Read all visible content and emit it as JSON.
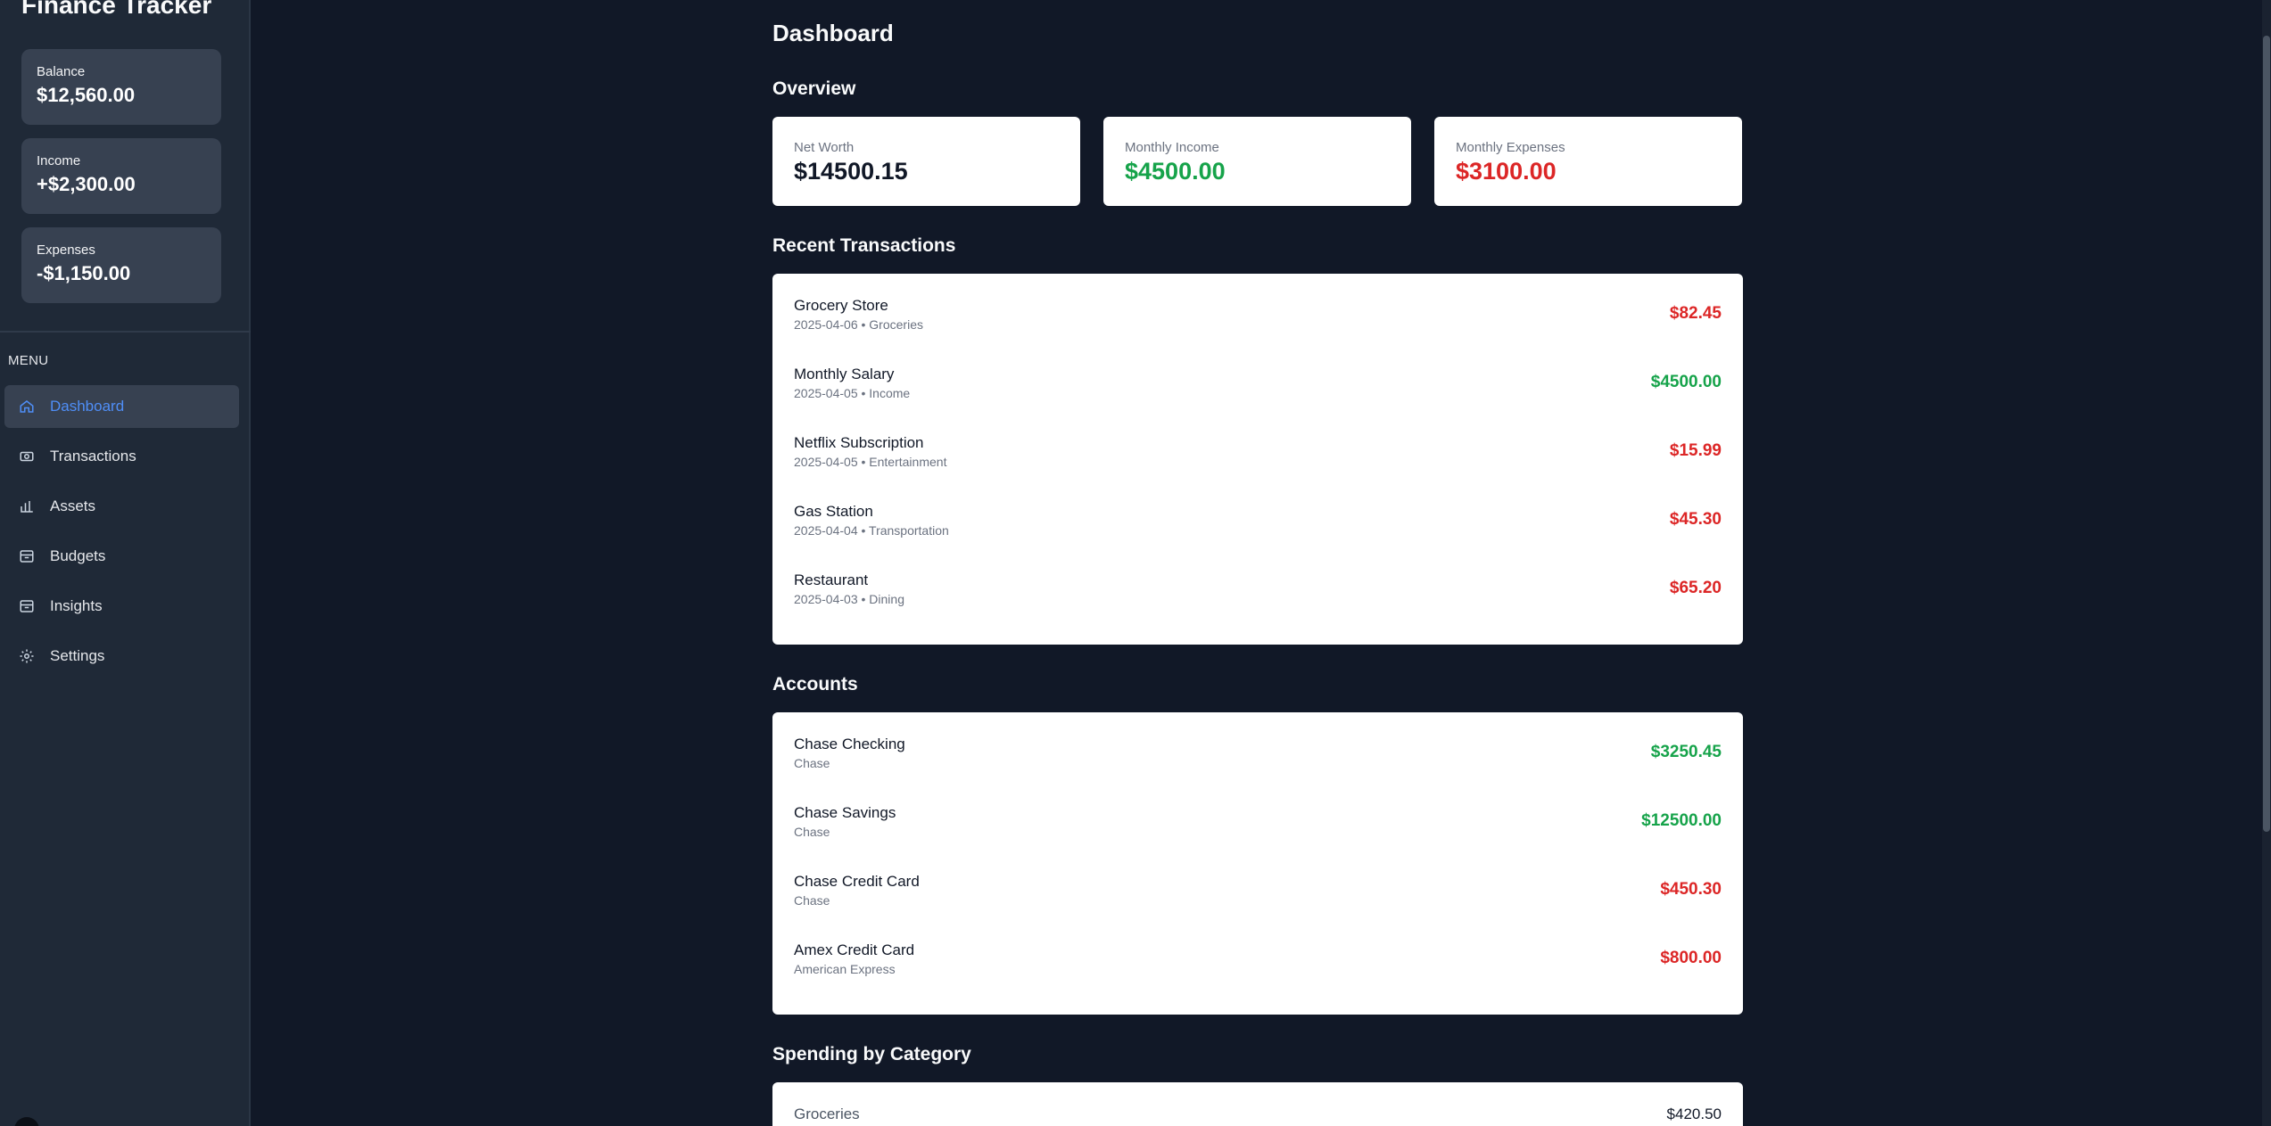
{
  "app": {
    "title": "Finance Tracker"
  },
  "sidebar": {
    "stats": [
      {
        "label": "Balance",
        "value": "$12,560.00"
      },
      {
        "label": "Income",
        "value": "+$2,300.00"
      },
      {
        "label": "Expenses",
        "value": "-$1,150.00"
      }
    ],
    "menu_label": "MENU",
    "items": [
      {
        "label": "Dashboard",
        "icon": "home-icon",
        "active": true
      },
      {
        "label": "Transactions",
        "icon": "cash-icon"
      },
      {
        "label": "Assets",
        "icon": "bar-chart-icon"
      },
      {
        "label": "Budgets",
        "icon": "archive-icon"
      },
      {
        "label": "Insights",
        "icon": "archive-icon"
      },
      {
        "label": "Settings",
        "icon": "gear-icon"
      }
    ]
  },
  "main": {
    "title": "Dashboard",
    "overview": {
      "title": "Overview",
      "cards": [
        {
          "label": "Net Worth",
          "value": "$14500.15",
          "color": "#111827"
        },
        {
          "label": "Monthly Income",
          "value": "$4500.00",
          "color": "#16a34a"
        },
        {
          "label": "Monthly Expenses",
          "value": "$3100.00",
          "color": "#dc2626"
        }
      ]
    },
    "transactions": {
      "title": "Recent Transactions",
      "rows": [
        {
          "name": "Grocery Store",
          "sub": "2025-04-06 • Groceries",
          "amount": "$82.45",
          "kind": "expense"
        },
        {
          "name": "Monthly Salary",
          "sub": "2025-04-05 • Income",
          "amount": "$4500.00",
          "kind": "income"
        },
        {
          "name": "Netflix Subscription",
          "sub": "2025-04-05 • Entertainment",
          "amount": "$15.99",
          "kind": "expense"
        },
        {
          "name": "Gas Station",
          "sub": "2025-04-04 • Transportation",
          "amount": "$45.30",
          "kind": "expense"
        },
        {
          "name": "Restaurant",
          "sub": "2025-04-03 • Dining",
          "amount": "$65.20",
          "kind": "expense"
        }
      ]
    },
    "accounts": {
      "title": "Accounts",
      "rows": [
        {
          "name": "Chase Checking",
          "sub": "Chase",
          "amount": "$3250.45",
          "kind": "income"
        },
        {
          "name": "Chase Savings",
          "sub": "Chase",
          "amount": "$12500.00",
          "kind": "income"
        },
        {
          "name": "Chase Credit Card",
          "sub": "Chase",
          "amount": "$450.30",
          "kind": "expense"
        },
        {
          "name": "Amex Credit Card",
          "sub": "American Express",
          "amount": "$800.00",
          "kind": "expense"
        }
      ]
    },
    "spending": {
      "title": "Spending by Category",
      "rows": [
        {
          "label": "Groceries",
          "value": "$420.50"
        }
      ]
    }
  },
  "colors": {
    "income": "#16a34a",
    "expense": "#dc2626",
    "accent": "#4f8ef7",
    "background": "#111827"
  }
}
